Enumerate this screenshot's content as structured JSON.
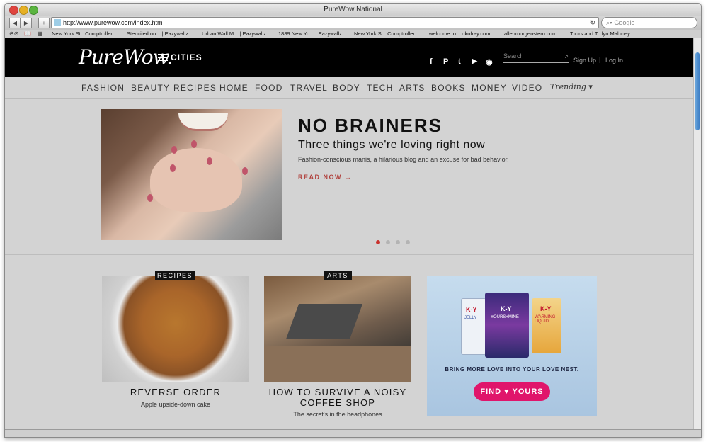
{
  "browser": {
    "title": "PureWow National",
    "url": "http://www.purewow.com/index.htm",
    "search_placeholder": "Google",
    "bookmarks": [
      "New York St...Comptroller",
      "Stenciled nu... | Eazywallz",
      "Urban Wall M... | Eazywallz",
      "1889 New Yo... | Eazywallz",
      "New York St...Comptroller",
      "welcome to ...okofray.com",
      "allenmorgenstern.com",
      "Tours and T...lyn Maloney"
    ]
  },
  "header": {
    "logo": "PureWow.",
    "cities_label": "CITIES",
    "social": [
      "f",
      "P",
      "t",
      "▶",
      "◉"
    ],
    "social_icons": [
      "facebook-icon",
      "pinterest-icon",
      "twitter-icon",
      "youtube-icon",
      "instagram-icon"
    ],
    "search_placeholder": "Search",
    "signup": "Sign Up",
    "divider": "|",
    "login": "Log In"
  },
  "nav": {
    "categories": [
      "FASHION",
      "BEAUTY",
      "RECIPES",
      "HOME",
      "FOOD",
      "TRAVEL",
      "BODY",
      "TECH",
      "ARTS",
      "BOOKS",
      "MONEY",
      "VIDEO"
    ],
    "trending": "Trending ▾"
  },
  "hero": {
    "title": "NO BRAINERS",
    "subtitle": "Three things we're loving right now",
    "description": "Fashion-conscious manis, a hilarious blog and an excuse for bad behavior.",
    "read_now": "READ NOW →",
    "slide_count": 4,
    "active_slide": 1
  },
  "cards": [
    {
      "tag": "RECIPES",
      "title": "REVERSE ORDER",
      "subtitle": "Apple upside-down cake"
    },
    {
      "tag": "ARTS",
      "title": "HOW TO SURVIVE A NOISY COFFEE SHOP",
      "subtitle": "The secret's in the headphones"
    }
  ],
  "ad": {
    "brand": "K-Y",
    "products": [
      "JELLY",
      "YOURS+MINE",
      "WARMING LIQUID"
    ],
    "tagline": "BRING MORE LOVE INTO YOUR LOVE NEST.",
    "button": "FIND ♥ YOURS"
  },
  "colors": {
    "accent_red": "#c9322d",
    "ad_pink": "#e0156b",
    "header_black": "#000000"
  }
}
